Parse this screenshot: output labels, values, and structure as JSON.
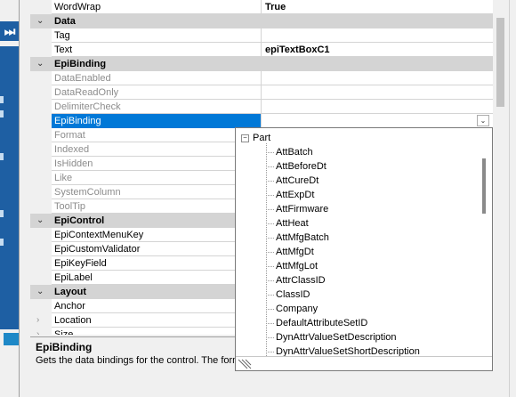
{
  "grid": {
    "rows": [
      {
        "kind": "prop",
        "name": "WordWrap",
        "value": "True"
      },
      {
        "kind": "category",
        "name": "Data"
      },
      {
        "kind": "prop",
        "name": "Tag",
        "value": ""
      },
      {
        "kind": "prop",
        "name": "Text",
        "value": "epiTextBoxC1"
      },
      {
        "kind": "category",
        "name": "EpiBinding"
      },
      {
        "kind": "disabled",
        "name": "DataEnabled",
        "value": ""
      },
      {
        "kind": "disabled",
        "name": "DataReadOnly",
        "value": ""
      },
      {
        "kind": "disabled",
        "name": "DelimiterCheck",
        "value": ""
      },
      {
        "kind": "selected",
        "name": "EpiBinding",
        "value": ""
      },
      {
        "kind": "disabled",
        "name": "Format",
        "value": ""
      },
      {
        "kind": "disabled",
        "name": "Indexed",
        "value": ""
      },
      {
        "kind": "disabled",
        "name": "IsHidden",
        "value": ""
      },
      {
        "kind": "disabled",
        "name": "Like",
        "value": ""
      },
      {
        "kind": "disabled",
        "name": "SystemColumn",
        "value": ""
      },
      {
        "kind": "disabled",
        "name": "ToolTip",
        "value": ""
      },
      {
        "kind": "category",
        "name": "EpiControl"
      },
      {
        "kind": "prop",
        "name": "EpiContextMenuKey",
        "value": ""
      },
      {
        "kind": "prop",
        "name": "EpiCustomValidator",
        "value": ""
      },
      {
        "kind": "prop",
        "name": "EpiKeyField",
        "value": ""
      },
      {
        "kind": "prop",
        "name": "EpiLabel",
        "value": ""
      },
      {
        "kind": "category",
        "name": "Layout"
      },
      {
        "kind": "prop",
        "name": "Anchor",
        "value": ""
      },
      {
        "kind": "collapsed",
        "name": "Location",
        "value": ""
      },
      {
        "kind": "collapsed",
        "name": "Size",
        "value": ""
      }
    ]
  },
  "popup": {
    "root_label": "Part",
    "root_toggle": "−",
    "items": [
      "AttBatch",
      "AttBeforeDt",
      "AttCureDt",
      "AttExpDt",
      "AttFirmware",
      "AttHeat",
      "AttMfgBatch",
      "AttMfgDt",
      "AttMfgLot",
      "AttrClassID",
      "ClassID",
      "Company",
      "DefaultAttributeSetID",
      "DynAttrValueSetDescription",
      "DynAttrValueSetShortDescription"
    ]
  },
  "description": {
    "title": "EpiBinding",
    "text": "Gets the data bindings for the control. The forma"
  },
  "left_strip": {
    "button_glyph": "⏭"
  },
  "icons": {
    "expand_caret": "chevron-down-icon",
    "collapsed_caret": "chevron-right-icon",
    "dropdown": "dropdown-arrow-icon",
    "tree_toggle": "minus-box-icon",
    "resize_grip": "resize-grip-icon"
  }
}
